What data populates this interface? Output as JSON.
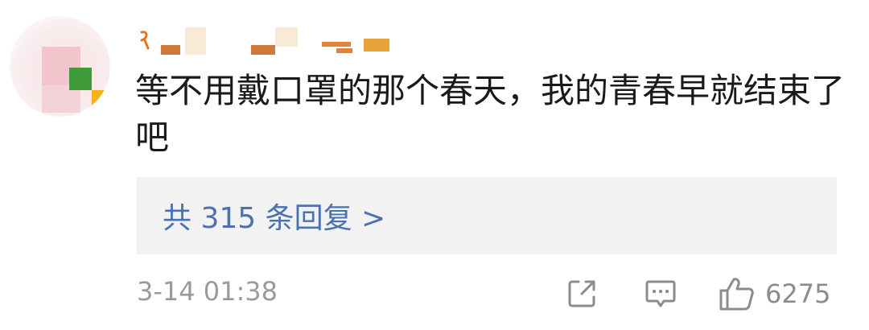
{
  "comment": {
    "text": "等不用戴口罩的那个春天，我的青春早就结束了吧"
  },
  "replies": {
    "label": "共 315 条回复 >"
  },
  "footer": {
    "timestamp": "3-14 01:38",
    "like_count": "6275"
  },
  "icons": {
    "share": "share-icon",
    "comment": "comment-icon",
    "like": "thumbs-up-icon"
  },
  "colors": {
    "reply_link": "#4a72b2",
    "meta_text": "#9a9a9a",
    "reply_panel_bg": "#f2f2f2"
  }
}
